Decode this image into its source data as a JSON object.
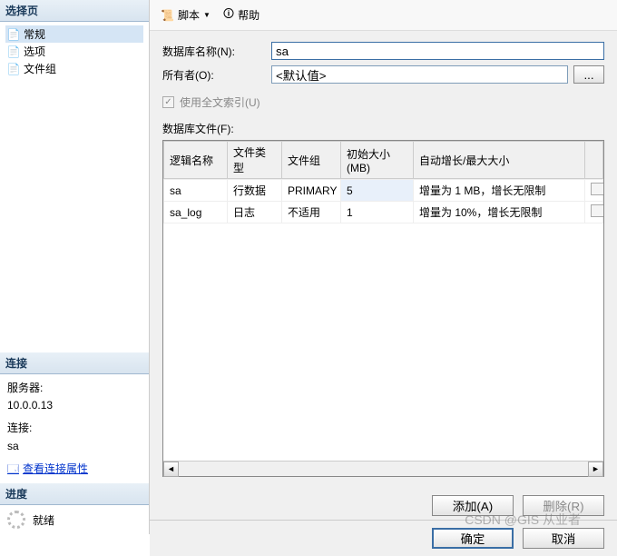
{
  "sidebar": {
    "select_header": "选择页",
    "items": [
      {
        "label": "常规",
        "icon": "page"
      },
      {
        "label": "选项",
        "icon": "page"
      },
      {
        "label": "文件组",
        "icon": "page"
      }
    ],
    "connection": {
      "header": "连接",
      "server_label": "服务器:",
      "server_value": "10.0.0.13",
      "conn_label": "连接:",
      "conn_value": "sa",
      "view_props": "查看连接属性"
    },
    "progress": {
      "header": "进度",
      "status": "就绪"
    }
  },
  "toolbar": {
    "script": "脚本",
    "help": "帮助"
  },
  "form": {
    "db_name_label": "数据库名称(N):",
    "db_name_value": "sa",
    "owner_label": "所有者(O):",
    "owner_value": "<默认值>",
    "fulltext_label": "使用全文索引(U)",
    "files_label": "数据库文件(F):"
  },
  "grid": {
    "columns": [
      "逻辑名称",
      "文件类型",
      "文件组",
      "初始大小(MB)",
      "自动增长/最大大小"
    ],
    "rows": [
      {
        "name": "sa",
        "type": "行数据",
        "group": "PRIMARY",
        "size": "5",
        "auto": "增量为 1 MB，增长无限制"
      },
      {
        "name": "sa_log",
        "type": "日志",
        "group": "不适用",
        "size": "1",
        "auto": "增量为 10%，增长无限制"
      }
    ]
  },
  "actions": {
    "add": "添加(A)",
    "remove": "删除(R)",
    "ok": "确定",
    "cancel": "取消"
  },
  "watermark": "CSDN @GIS 从业者"
}
